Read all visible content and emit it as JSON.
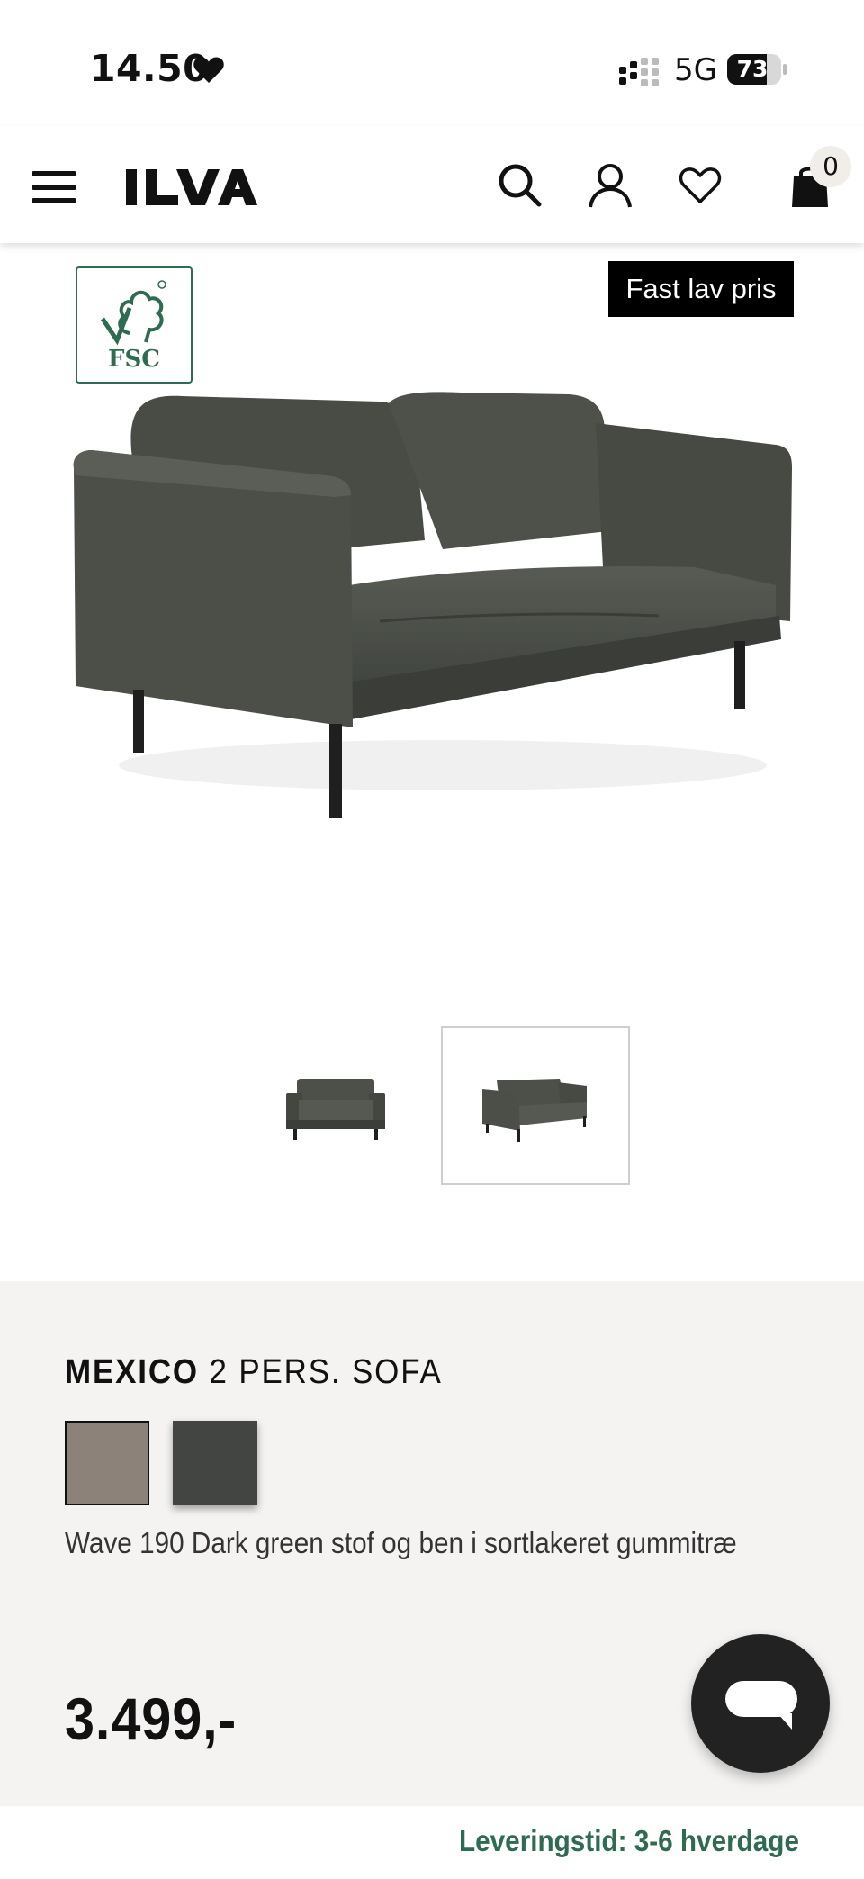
{
  "status_bar": {
    "time": "14.50",
    "network": "5G",
    "battery": "73",
    "battery_level": 0.73
  },
  "header": {
    "logo": "ILVA",
    "cart_count": "0"
  },
  "product": {
    "fsc_label": "FSC",
    "badge": "Fast lav pris",
    "brand": "MEXICO",
    "name": "2 PERS. SOFA",
    "swatches": [
      {
        "name": "taupe",
        "color": "#8c8279"
      },
      {
        "name": "dark-green",
        "color": "#434542"
      }
    ],
    "description": "Wave 190 Dark green stof og ben i sortlakeret gummitræ",
    "price": "3.499,-",
    "delivery": "Leveringstid: 3-6 hverdage"
  },
  "colors": {
    "accent": "#2e6b50",
    "panel": "#f4f3f1",
    "sofa": "#4a4e47"
  },
  "icons": [
    "heart-icon",
    "signal-icon",
    "menu-icon",
    "search-icon",
    "user-icon",
    "heart-outline-icon",
    "shopping-bag-icon",
    "chat-icon"
  ]
}
